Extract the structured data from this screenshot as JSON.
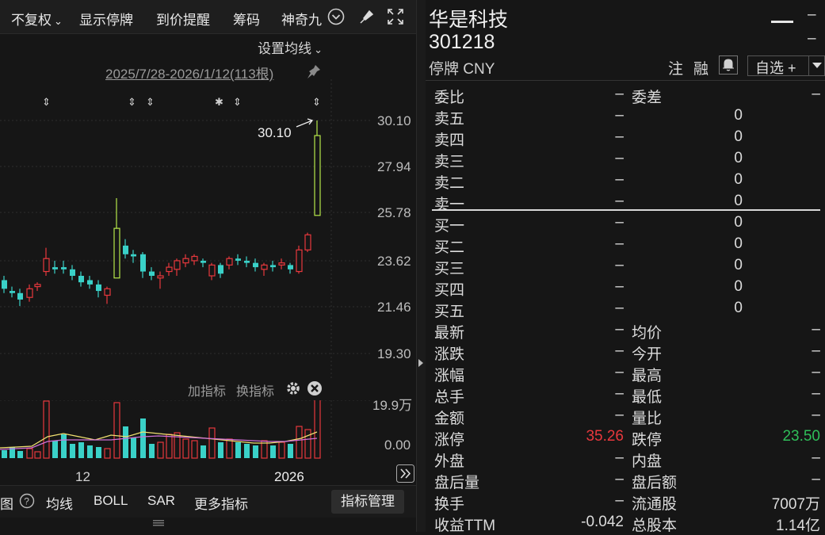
{
  "toolbar": {
    "adjust": "不复权",
    "show_halt": "显示停牌",
    "price_alert": "到价提醒",
    "chips": "筹码",
    "magic_nine": "神奇九"
  },
  "chart": {
    "ma_setting": "设置均线",
    "range_label": "2025/7/28-2026/1/12(113根)",
    "price_labels": [
      "30.10",
      "27.94",
      "25.78",
      "23.62",
      "21.46",
      "19.30"
    ],
    "last_price_annotation": "30.10",
    "volume_max_label": "19.9万",
    "volume_min_label": "0.00",
    "add_indicator": "加指标",
    "swap_indicator": "换指标",
    "x_labels": [
      "12",
      "2026"
    ],
    "colors": {
      "up": "#e8383d",
      "down": "#3ad1c8",
      "halt": "#b6e84a"
    }
  },
  "bottombar": {
    "left_partial": "图",
    "tabs": [
      "均线",
      "BOLL",
      "SAR",
      "更多指标"
    ],
    "indicator_manage": "指标管理"
  },
  "quote": {
    "name": "华是科技",
    "code": "301218",
    "status": "停牌 CNY",
    "zhu": "注",
    "rong": "融",
    "watch": "自选 +",
    "weibi_label": "委比",
    "weibi_value": "–",
    "weicha_label": "委差",
    "weicha_value": "–",
    "sell": [
      {
        "label": "卖五",
        "price": "–",
        "vol": "0"
      },
      {
        "label": "卖四",
        "price": "–",
        "vol": "0"
      },
      {
        "label": "卖三",
        "price": "–",
        "vol": "0"
      },
      {
        "label": "卖二",
        "price": "–",
        "vol": "0"
      },
      {
        "label": "卖一",
        "price": "–",
        "vol": "0"
      }
    ],
    "buy": [
      {
        "label": "买一",
        "price": "–",
        "vol": "0"
      },
      {
        "label": "买二",
        "price": "–",
        "vol": "0"
      },
      {
        "label": "买三",
        "price": "–",
        "vol": "0"
      },
      {
        "label": "买四",
        "price": "–",
        "vol": "0"
      },
      {
        "label": "买五",
        "price": "–",
        "vol": "0"
      }
    ],
    "stats": [
      {
        "l1": "最新",
        "v1": "–",
        "l2": "均价",
        "v2": "–"
      },
      {
        "l1": "涨跌",
        "v1": "–",
        "l2": "今开",
        "v2": "–"
      },
      {
        "l1": "涨幅",
        "v1": "–",
        "l2": "最高",
        "v2": "–"
      },
      {
        "l1": "总手",
        "v1": "–",
        "l2": "最低",
        "v2": "–"
      },
      {
        "l1": "金额",
        "v1": "–",
        "l2": "量比",
        "v2": "–"
      },
      {
        "l1": "涨停",
        "v1": "35.26",
        "l2": "跌停",
        "v2": "23.50"
      },
      {
        "l1": "外盘",
        "v1": "–",
        "l2": "内盘",
        "v2": "–"
      },
      {
        "l1": "盘后量",
        "v1": "–",
        "l2": "盘后额",
        "v2": "–"
      },
      {
        "l1": "换手",
        "v1": "–",
        "l2": "流通股",
        "v2": "7007万"
      },
      {
        "l1": "收益TTM",
        "v1": "-0.042",
        "l2": "总股本",
        "v2": "1.14亿"
      }
    ]
  }
}
